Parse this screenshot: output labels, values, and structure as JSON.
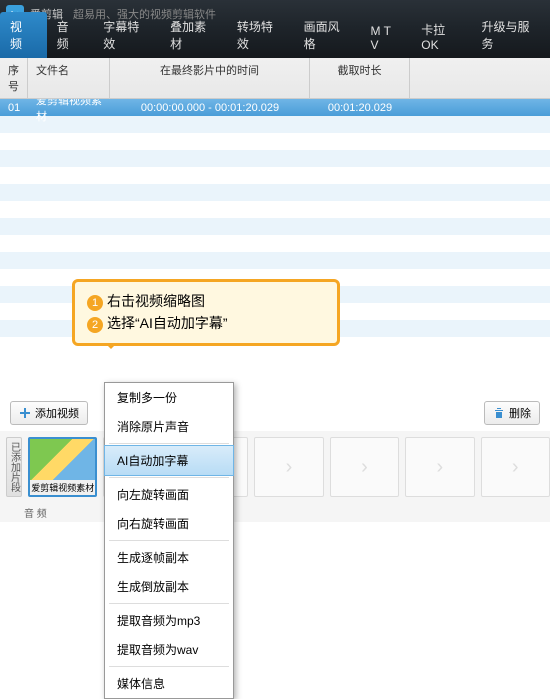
{
  "app": {
    "name": "爱剪辑",
    "slogan": "超易用、强大的视频剪辑软件"
  },
  "tabs": [
    "视 频",
    "音 频",
    "字幕特效",
    "叠加素材",
    "转场特效",
    "画面风格",
    "M T V",
    "卡拉OK",
    "升级与服务"
  ],
  "columns": {
    "c0": "序号",
    "c1": "文件名",
    "c2": "在最终影片中的时间",
    "c3": "截取时长"
  },
  "rows": [
    {
      "no": "01",
      "file": "爱剪辑视频素材",
      "time": "00:00:00.000 - 00:01:20.029",
      "dur": "00:01:20.029",
      "sel": true
    }
  ],
  "callout": {
    "l1": "右击视频缩略图",
    "l2": "选择“AI自动加字幕”"
  },
  "toolbar": {
    "add": "添加视频",
    "del": "删除"
  },
  "strip": {
    "side": "已添加片段",
    "thumb": "爱剪辑视频素材",
    "audio": "音 频"
  },
  "slotArrow": "›",
  "ctx": {
    "g1": [
      "复制多一份",
      "消除原片声音"
    ],
    "hl": "AI自动加字幕",
    "g2": [
      "向左旋转画面",
      "向右旋转画面"
    ],
    "g3": [
      "生成逐帧副本",
      "生成倒放副本"
    ],
    "g4": [
      "提取音频为mp3",
      "提取音频为wav"
    ],
    "g5": [
      "媒体信息"
    ]
  }
}
